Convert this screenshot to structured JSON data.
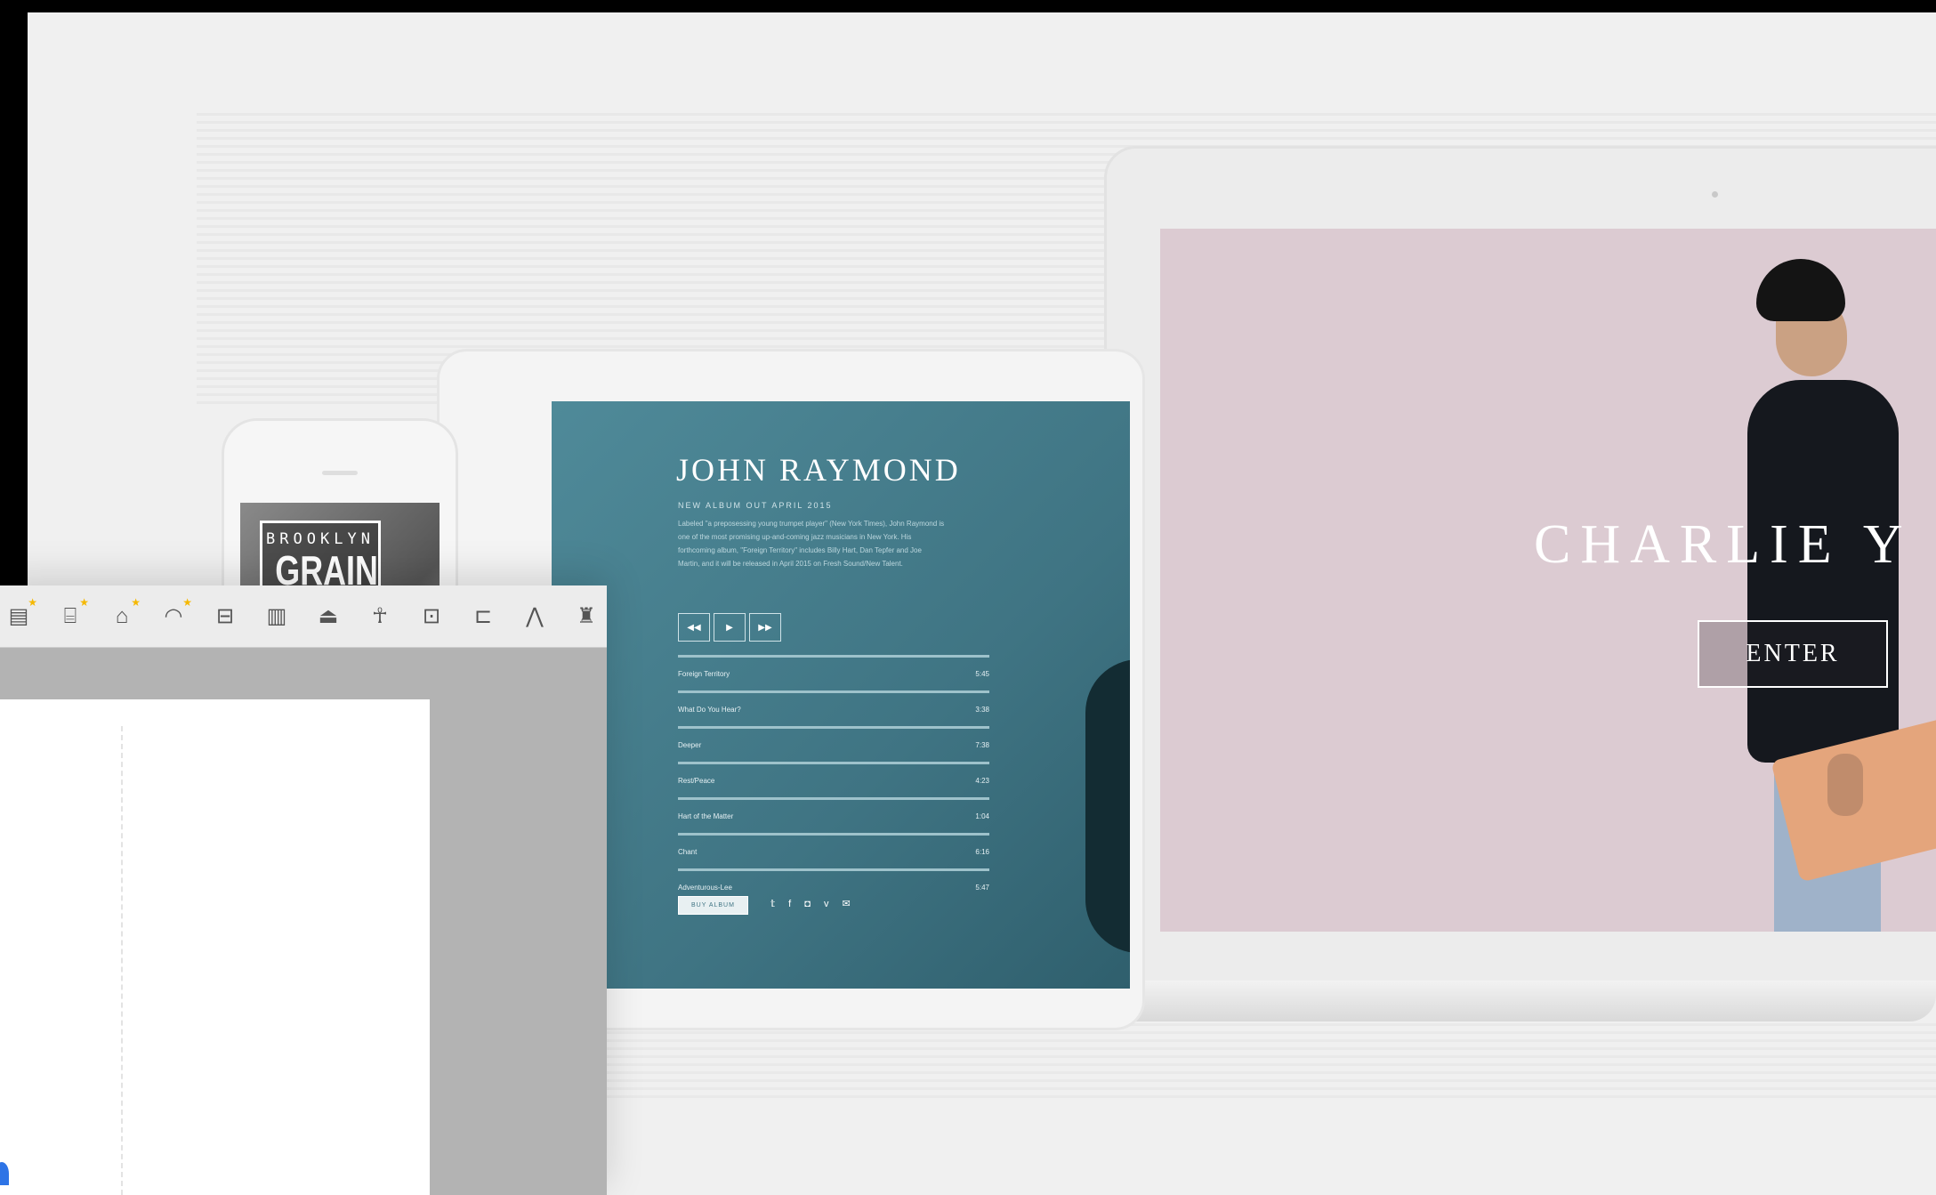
{
  "phone": {
    "logo_top": "BROOKLYN",
    "logo_main": "GRAIN"
  },
  "tablet": {
    "title": "JOHN RAYMOND",
    "subtitle": "NEW ALBUM OUT APRIL 2015",
    "body": "Labeled \"a preposessing young trumpet player\" (New York Times), John Raymond is one of the most promising up-and-coming jazz musicians in New York. His forthcoming album, \"Foreign Territory\" includes Billy Hart, Dan Tepfer and Joe Martin, and it will be released in April 2015 on Fresh Sound/New Talent.",
    "controls": [
      "◀◀",
      "▶",
      "▶▶"
    ],
    "tracks": [
      {
        "name": "Foreign Territory",
        "time": "5:45"
      },
      {
        "name": "What Do You Hear?",
        "time": "3:38"
      },
      {
        "name": "Deeper",
        "time": "7:38"
      },
      {
        "name": "Rest/Peace",
        "time": "4:23"
      },
      {
        "name": "Hart of the Matter",
        "time": "1:04"
      },
      {
        "name": "Chant",
        "time": "6:16"
      },
      {
        "name": "Adventurous-Lee",
        "time": "5:47"
      }
    ],
    "buy_label": "BUY ALBUM",
    "social": "𝕥 f ◘ v ✉"
  },
  "laptop": {
    "title": "CHARLIE Y",
    "enter_label": "ENTER"
  },
  "toolbar": {
    "tools": [
      {
        "icon": "▤",
        "name": "tool-building-icon",
        "star": true
      },
      {
        "icon": "⌸",
        "name": "tool-roof-icon",
        "star": true
      },
      {
        "icon": "⌂",
        "name": "tool-house-icon",
        "star": true
      },
      {
        "icon": "◠",
        "name": "tool-dome-icon",
        "star": true
      },
      {
        "icon": "⊟",
        "name": "tool-barn-icon",
        "star": false
      },
      {
        "icon": "▥",
        "name": "tool-tower-icon",
        "star": false
      },
      {
        "icon": "⏏",
        "name": "tool-hall-icon",
        "star": false
      },
      {
        "icon": "☥",
        "name": "tool-needle-icon",
        "star": false
      },
      {
        "icon": "⊡",
        "name": "tool-frame-icon",
        "star": false
      },
      {
        "icon": "⊏",
        "name": "tool-flag-icon",
        "star": false
      },
      {
        "icon": "⋀",
        "name": "tool-tent-icon",
        "star": false
      },
      {
        "icon": "♜",
        "name": "tool-monument-icon",
        "star": false
      },
      {
        "icon": "⟋",
        "name": "tool-ramp-icon",
        "star": false
      }
    ]
  },
  "star_glyph": "★"
}
